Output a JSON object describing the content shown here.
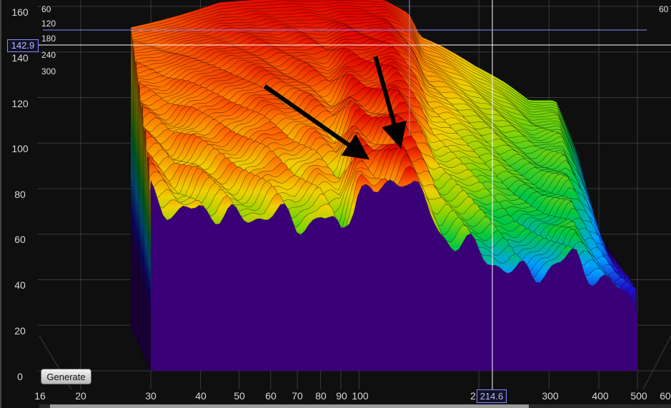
{
  "y_axis": {
    "ticks": [
      "160",
      "140",
      "120",
      "100",
      "80",
      "60",
      "40",
      "20",
      "0"
    ]
  },
  "x_axis": {
    "ticks": [
      "16",
      "20",
      "30",
      "40",
      "50",
      "60",
      "70",
      "80",
      "90",
      "100",
      "2",
      "300",
      "400",
      "500",
      "60"
    ]
  },
  "time_slices": {
    "labels": [
      "60",
      "120",
      "180",
      "240",
      "300"
    ],
    "right_label": "60"
  },
  "cursor": {
    "level": "142.9",
    "frequency": "214.6"
  },
  "controls": {
    "generate_label": "Generate"
  },
  "chart_data": {
    "type": "area",
    "title": "",
    "xlabel": "",
    "ylabel": "",
    "x_scale": "log",
    "xlim": [
      16,
      600
    ],
    "ylim": [
      0,
      160
    ],
    "z_slices_ms": [
      60,
      120,
      180,
      240,
      300
    ],
    "colormap": [
      "#3a0078",
      "#1b10d0",
      "#00a0ff",
      "#00c840",
      "#8cd400",
      "#f0d000",
      "#ff7000",
      "#e00000"
    ],
    "front_slice": {
      "frequency": [
        30,
        35,
        40,
        50,
        60,
        70,
        80,
        90,
        100,
        110,
        130,
        160,
        200,
        250,
        300,
        350,
        400,
        450,
        500
      ],
      "level": [
        80,
        67,
        72,
        66,
        70,
        64,
        68,
        60,
        82,
        76,
        88,
        60,
        52,
        42,
        45,
        50,
        40,
        35,
        30
      ]
    },
    "back_slice_peak": {
      "frequency": [
        30,
        50,
        70,
        90,
        110,
        130,
        150,
        160,
        180,
        220,
        260,
        300,
        350,
        400,
        450,
        500
      ],
      "level": [
        132,
        143,
        145,
        145,
        145,
        144,
        138,
        128,
        124,
        115,
        108,
        100,
        100,
        75,
        40,
        30
      ]
    },
    "annotations": [
      {
        "type": "arrow",
        "from": [
          58,
          125
        ],
        "to": [
          100,
          96
        ]
      },
      {
        "type": "arrow",
        "from": [
          110,
          138
        ],
        "to": [
          125,
          103
        ]
      }
    ]
  }
}
